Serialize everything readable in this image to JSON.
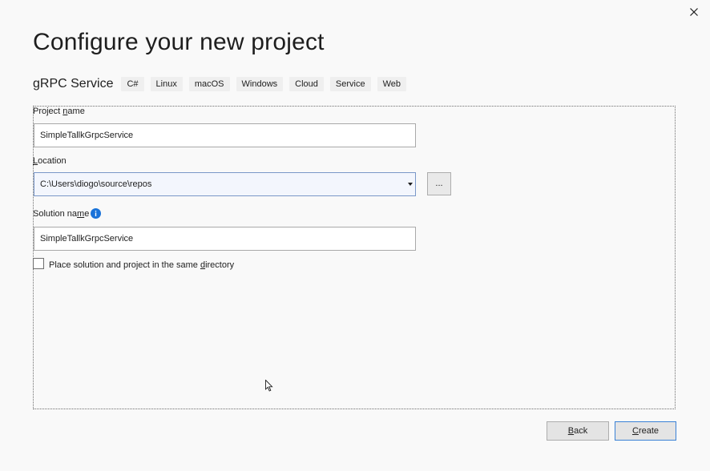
{
  "dialog": {
    "title": "Configure your new project",
    "close_icon": "close-icon"
  },
  "template": {
    "name": "gRPC Service",
    "tags": [
      "C#",
      "Linux",
      "macOS",
      "Windows",
      "Cloud",
      "Service",
      "Web"
    ]
  },
  "form": {
    "project_name": {
      "label_pre": "Project ",
      "label_accel": "n",
      "label_post": "ame",
      "value": "SimpleTallkGrpcService"
    },
    "location": {
      "label_pre": "",
      "label_accel": "L",
      "label_post": "ocation",
      "value": "C:\\Users\\diogo\\source\\repos",
      "browse_label": "..."
    },
    "solution_name": {
      "label_pre": "Solution na",
      "label_accel": "m",
      "label_post": "e",
      "value": "SimpleTallkGrpcService",
      "info_icon": "info-icon"
    },
    "same_directory": {
      "label_pre": "Place solution and project in the same ",
      "label_accel": "d",
      "label_post": "irectory",
      "checked": false
    }
  },
  "footer": {
    "back_accel": "B",
    "back_rest": "ack",
    "create_accel": "C",
    "create_rest": "reate"
  },
  "colors": {
    "background": "#f9f9f9",
    "accent_border": "#3b82d6",
    "info_icon": "#1a73d9"
  }
}
